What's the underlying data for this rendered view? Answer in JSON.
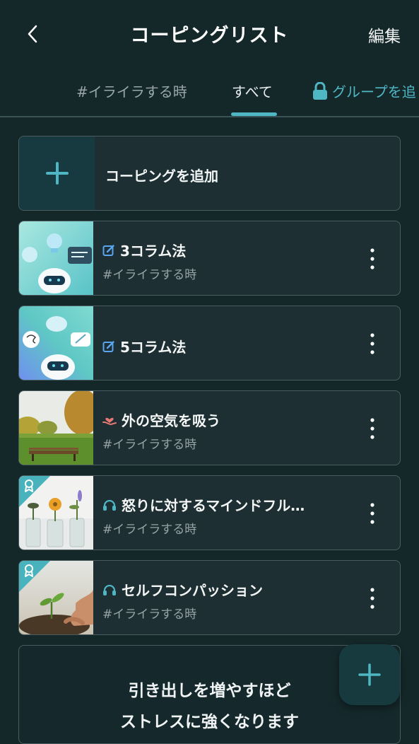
{
  "header": {
    "title": "コーピングリスト",
    "edit_label": "編集"
  },
  "tabs": [
    {
      "label": "#イライラする時"
    },
    {
      "label": "すべて"
    },
    {
      "label": "グループを追"
    }
  ],
  "add_card": {
    "label": "コーピングを追加"
  },
  "items": [
    {
      "title": "3コラム法",
      "subtitle": "#イライラする時",
      "type_icon": "edit-icon"
    },
    {
      "title": "5コラム法",
      "subtitle": "",
      "type_icon": "edit-icon"
    },
    {
      "title": "外の空気を吸う",
      "subtitle": "#イライラする時",
      "type_icon": "heart-hand-icon"
    },
    {
      "title": "怒りに対するマインドフル…",
      "subtitle": "#イライラする時",
      "type_icon": "headphones-icon"
    },
    {
      "title": "セルフコンパッション",
      "subtitle": "#イライラする時",
      "type_icon": "headphones-icon"
    }
  ],
  "promo": {
    "line1": "引き出しを増やすほど",
    "line2": "ストレスに強くなります"
  },
  "colors": {
    "background": "#14282a",
    "accent": "#4fb6c4",
    "card": "#1d2f32"
  }
}
